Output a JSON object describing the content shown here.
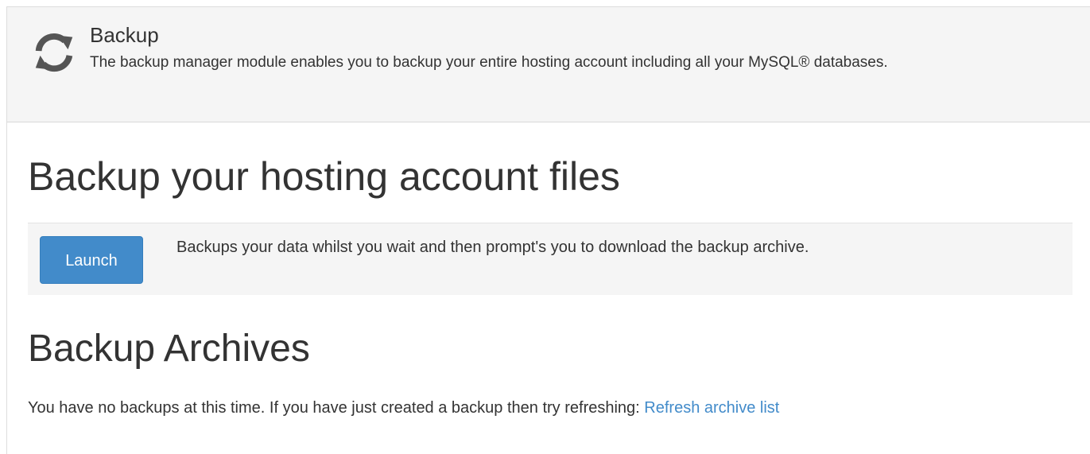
{
  "module": {
    "icon": "refresh-sync-icon",
    "title": "Backup",
    "description": "The backup manager module enables you to backup your entire hosting account including all your MySQL® databases."
  },
  "backup_files": {
    "heading": "Backup your hosting account files",
    "launch_label": "Launch",
    "launch_description": "Backups your data whilst you wait and then prompt's you to download the backup archive."
  },
  "archives": {
    "heading": "Backup Archives",
    "empty_message": "You have no backups at this time. If you have just created a backup then try refreshing: ",
    "refresh_link_label": "Refresh archive list"
  },
  "colors": {
    "accent": "#428bca",
    "header_bg": "#f5f5f5",
    "text": "#333333",
    "icon": "#555555"
  }
}
